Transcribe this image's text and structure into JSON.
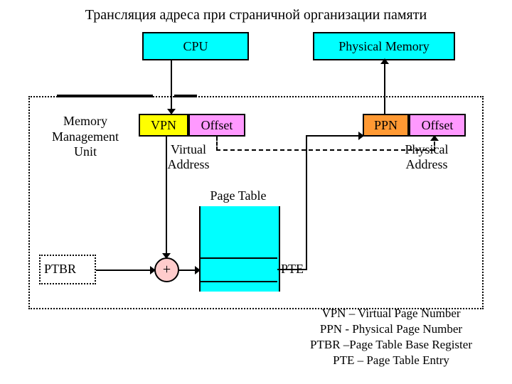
{
  "title": "Трансляция адреса при страничной организации памяти",
  "boxes": {
    "cpu": "CPU",
    "pmem": "Physical Memory",
    "vpn": "VPN",
    "voffset": "Offset",
    "ppn": "PPN",
    "poffset": "Offset",
    "plus": "+"
  },
  "labels": {
    "mmu": "Memory\nManagement\nUnit",
    "va": "Virtual\nAddress",
    "pa": "Physical\nAddress",
    "pt": "Page Table",
    "pte": "PTE",
    "ptbr": "PTBR"
  },
  "legend": {
    "l1": "VPN – Virtual Page Number",
    "l2": "PPN - Physical Page Number",
    "l3": "PTBR –Page Table Base Register",
    "l4": "PTE – Page Table Entry"
  }
}
